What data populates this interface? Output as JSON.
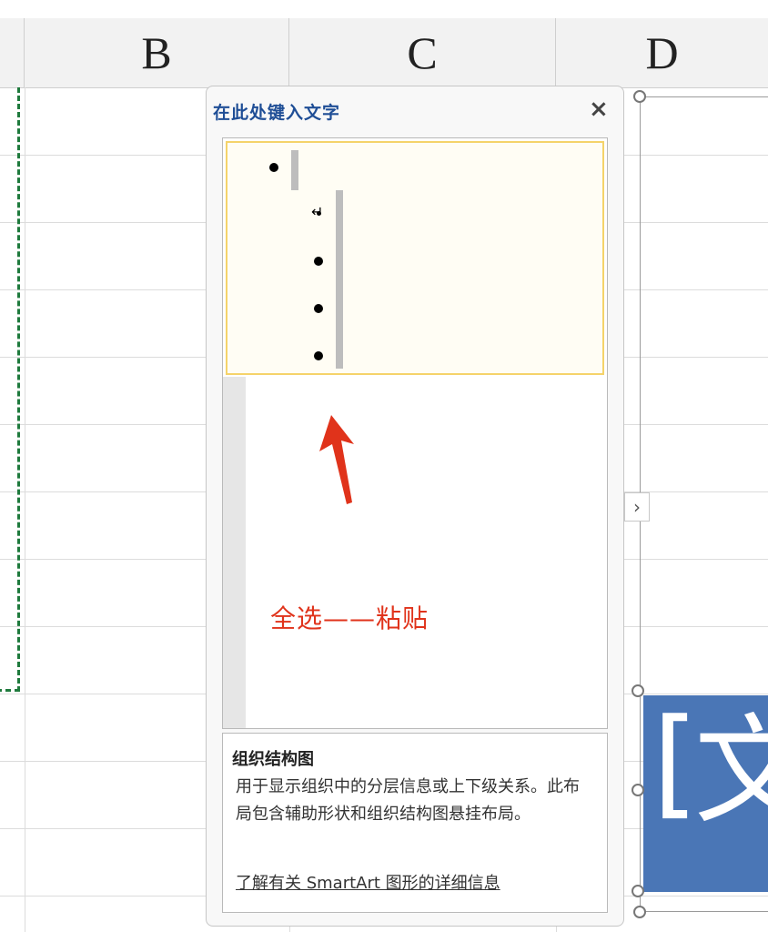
{
  "sheet": {
    "columns": [
      "B",
      "C",
      "D"
    ]
  },
  "text_pane": {
    "title": "在此处键入文字",
    "close_glyph": "×",
    "annotation": "全选——粘贴",
    "return_glyph": "↵",
    "description": {
      "title": "组织结构图",
      "body": "用于显示组织中的分层信息或上下级关系。此布局包含辅助形状和组织结构图悬挂布局。",
      "link": "了解有关 SmartArt 图形的详细信息"
    }
  },
  "smartart": {
    "shape_text": "文",
    "bracket": "[",
    "expand_glyph": "›"
  },
  "colors": {
    "title_blue": "#1f4e96",
    "annotation_red": "#e0331b",
    "selection_border": "#f5d36a",
    "marquee_green": "#1f7a3d",
    "shape_blue": "#4a76b6"
  },
  "icons": [
    "close-icon",
    "chevron-right-icon",
    "red-arrow-icon"
  ]
}
